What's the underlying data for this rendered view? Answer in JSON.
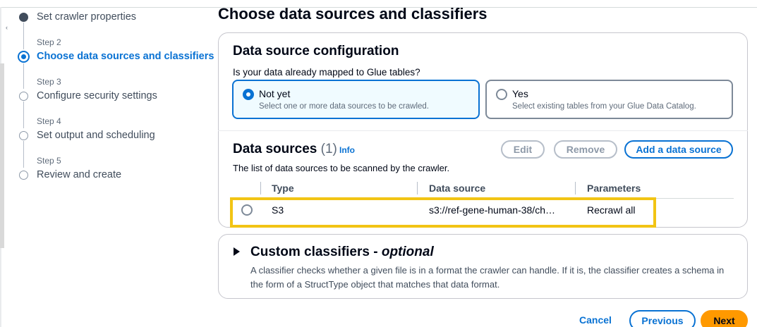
{
  "wizard": {
    "steps": [
      {
        "sub": "",
        "label": "Set crawler properties",
        "state": "completed"
      },
      {
        "sub": "Step 2",
        "label": "Choose data sources and classifiers",
        "state": "active"
      },
      {
        "sub": "Step 3",
        "label": "Configure security settings",
        "state": "pending"
      },
      {
        "sub": "Step 4",
        "label": "Set output and scheduling",
        "state": "pending"
      },
      {
        "sub": "Step 5",
        "label": "Review and create",
        "state": "pending"
      }
    ]
  },
  "page": {
    "title": "Choose data sources and classifiers"
  },
  "config": {
    "title": "Data source configuration",
    "question": "Is your data already mapped to Glue tables?",
    "options": [
      {
        "label": "Not yet",
        "desc": "Select one or more data sources to be crawled.",
        "checked": true
      },
      {
        "label": "Yes",
        "desc": "Select existing tables from your Glue Data Catalog.",
        "checked": false
      }
    ]
  },
  "data_sources": {
    "title": "Data sources",
    "count": "(1)",
    "info": "Info",
    "desc": "The list of data sources to be scanned by the crawler.",
    "buttons": {
      "edit": "Edit",
      "remove": "Remove",
      "add": "Add a data source"
    },
    "columns": [
      "Type",
      "Data source",
      "Parameters"
    ],
    "rows": [
      {
        "type": "S3",
        "source": "s3://ref-gene-human-38/ch…",
        "params": "Recrawl all"
      }
    ],
    "highlight_color": "#f2c414"
  },
  "classifiers": {
    "title": "Custom classifiers - ",
    "title_optional": "optional",
    "desc": "A classifier checks whether a given file is in a format the crawler can handle. If it is, the classifier creates a schema in the form of a StructType object that matches that data format."
  },
  "footer": {
    "cancel": "Cancel",
    "previous": "Previous",
    "next": "Next"
  },
  "colors": {
    "accent": "#0972d3",
    "primary": "#ff9900"
  }
}
